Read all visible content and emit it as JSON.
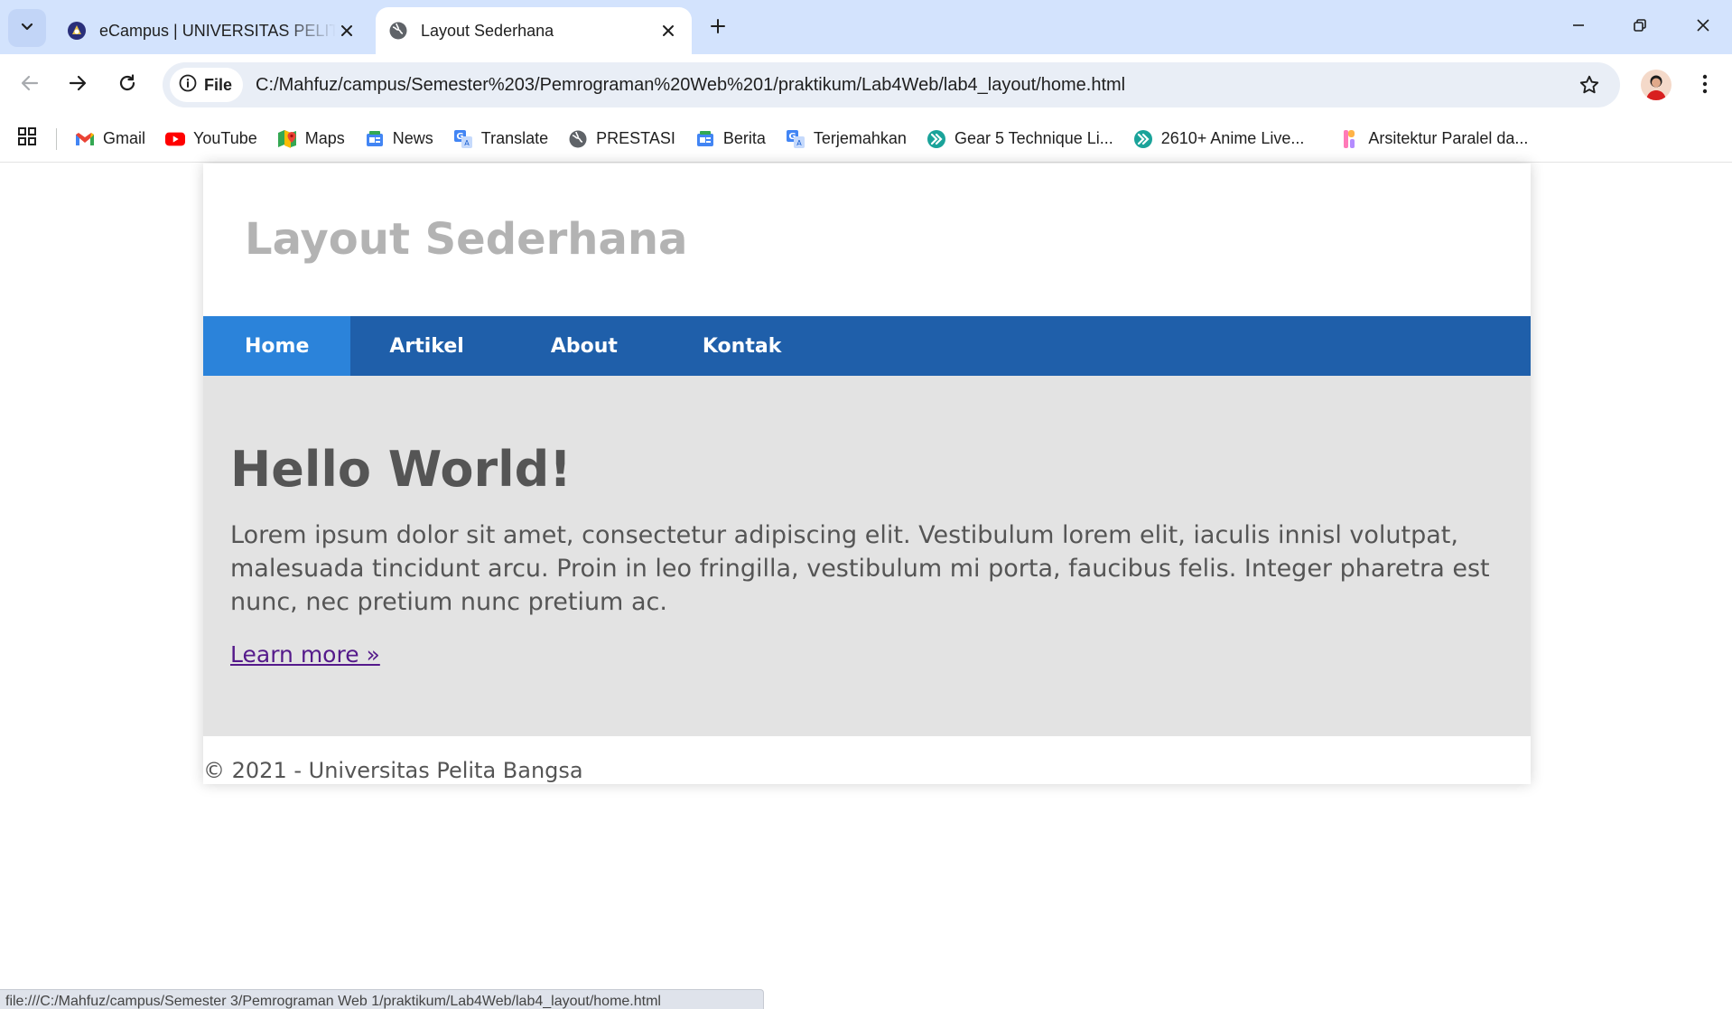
{
  "browser": {
    "tabs": [
      {
        "title": "eCampus | UNIVERSITAS PELITA BANGSA",
        "favicon": "university-logo-icon"
      },
      {
        "title": "Layout Sederhana",
        "favicon": "globe-icon"
      }
    ],
    "address": {
      "chip_label": "File",
      "url": "C:/Mahfuz/campus/Semester%203/Pemrograman%20Web%201/praktikum/Lab4Web/lab4_layout/home.html"
    },
    "bookmarks": [
      {
        "label": "Gmail",
        "icon": "gmail-icon"
      },
      {
        "label": "YouTube",
        "icon": "youtube-icon"
      },
      {
        "label": "Maps",
        "icon": "maps-icon"
      },
      {
        "label": "News",
        "icon": "news-icon"
      },
      {
        "label": "Translate",
        "icon": "translate-icon"
      },
      {
        "label": "PRESTASI",
        "icon": "globe-icon"
      },
      {
        "label": "Berita",
        "icon": "news-icon"
      },
      {
        "label": "Terjemahkan",
        "icon": "translate-icon"
      },
      {
        "label": "Gear 5 Technique Li...",
        "icon": "anime-site-icon"
      },
      {
        "label": "2610+ Anime Live...",
        "icon": "anime-site-icon"
      },
      {
        "label": "Arsitektur Paralel da...",
        "icon": "doc-site-icon"
      }
    ],
    "status_url": "file:///C:/Mahfuz/campus/Semester 3/Pemrograman Web 1/praktikum/Lab4Web/lab4_layout/home.html"
  },
  "page": {
    "site_title": "Layout Sederhana",
    "nav": [
      {
        "label": "Home",
        "active": true
      },
      {
        "label": "Artikel",
        "active": false
      },
      {
        "label": "About",
        "active": false
      },
      {
        "label": "Kontak",
        "active": false
      }
    ],
    "hero": {
      "heading": "Hello World!",
      "body": "Lorem ipsum dolor sit amet, consectetur adipiscing elit. Vestibulum lorem elit, iaculis innisl volutpat, malesuada tincidunt arcu. Proin in leo fringilla, vestibulum mi porta, faucibus felis. Integer pharetra est nunc, nec pretium nunc pretium ac.",
      "link": "Learn more »"
    },
    "footer": "© 2021 - Universitas Pelita Bangsa"
  },
  "colors": {
    "tabstrip": "#d3e3fd",
    "nav_bar": "#1f5faa",
    "nav_active": "#2b83da",
    "hero_bg": "#e3e3e3",
    "link_visited": "#551a8b"
  }
}
